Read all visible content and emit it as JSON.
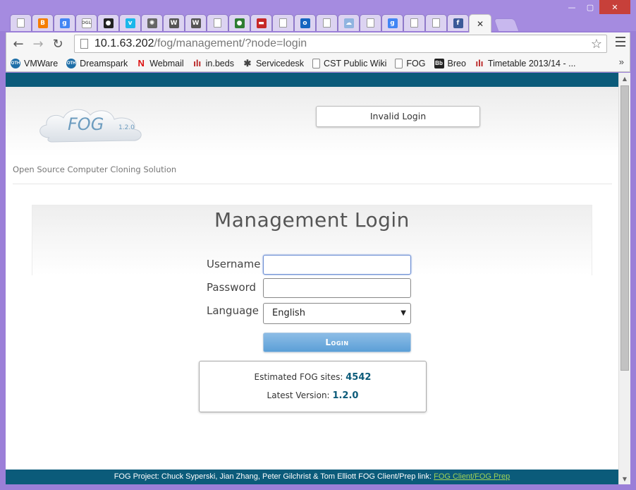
{
  "window": {
    "minimize": "—",
    "maximize": "▢",
    "close": "✕"
  },
  "tabs": [
    {
      "icon": "doc"
    },
    {
      "icon": "blogger",
      "color": "#f57d00",
      "glyph": "B"
    },
    {
      "icon": "google",
      "color": "#4285f4",
      "glyph": "g"
    },
    {
      "icon": "ogl",
      "color": "#777777",
      "glyph": "OGL"
    },
    {
      "icon": "github",
      "color": "#222222",
      "glyph": "●"
    },
    {
      "icon": "vimeo",
      "color": "#1ab7ea",
      "glyph": "v"
    },
    {
      "icon": "gear",
      "color": "#666666",
      "glyph": "✺"
    },
    {
      "icon": "wikipedia",
      "color": "#555555",
      "glyph": "W"
    },
    {
      "icon": "wikipedia",
      "color": "#555555",
      "glyph": "W"
    },
    {
      "icon": "doc"
    },
    {
      "icon": "circle-green",
      "color": "#2e7d32",
      "glyph": "●"
    },
    {
      "icon": "ikea",
      "color": "#c62828",
      "glyph": "▬"
    },
    {
      "icon": "doc"
    },
    {
      "icon": "outlook",
      "color": "#1565c0",
      "glyph": "o"
    },
    {
      "icon": "doc"
    },
    {
      "icon": "cloud",
      "color": "#90b4e0",
      "glyph": "☁"
    },
    {
      "icon": "doc"
    },
    {
      "icon": "google",
      "color": "#4285f4",
      "glyph": "g"
    },
    {
      "icon": "doc"
    },
    {
      "icon": "doc"
    },
    {
      "icon": "facebook",
      "color": "#3b5998",
      "glyph": "f"
    }
  ],
  "active_tab": {
    "close": "✕"
  },
  "toolbar": {
    "back": "←",
    "forward": "→",
    "reload": "↻",
    "url_host": "10.1.63.202",
    "url_path": "/fog/management/?node=login",
    "star": "☆"
  },
  "bookmarks": [
    {
      "label": "VMWare",
      "icon": "oth-icon",
      "color": "#1f6fa8",
      "glyph": "OTH"
    },
    {
      "label": "Dreamspark",
      "icon": "oth-icon",
      "color": "#1f6fa8",
      "glyph": "OTH"
    },
    {
      "label": "Webmail",
      "icon": "n-icon",
      "color": "#d11",
      "glyph": "N"
    },
    {
      "label": "in.beds",
      "icon": "bars-icon",
      "color": "#b71c1c",
      "glyph": "ılı"
    },
    {
      "label": "Servicedesk",
      "icon": "asterisk-icon",
      "color": "#444",
      "glyph": "✱"
    },
    {
      "label": "CST Public Wiki",
      "icon": "doc-icon",
      "color": "#ffffff",
      "glyph": ""
    },
    {
      "label": "FOG",
      "icon": "doc-icon",
      "color": "#ffffff",
      "glyph": ""
    },
    {
      "label": "Breo",
      "icon": "bb-icon",
      "color": "#222",
      "glyph": "Bb"
    },
    {
      "label": "Timetable 2013/14 - ...",
      "icon": "bars-icon",
      "color": "#b71c1c",
      "glyph": "ılı"
    }
  ],
  "bookmarks_more": "»",
  "page": {
    "logo_text": "FOG",
    "logo_version": "1.2.0",
    "tagline": "Open Source Computer Cloning Solution",
    "notice": "Invalid Login",
    "login_title": "Management Login",
    "username_label": "Username",
    "password_label": "Password",
    "language_label": "Language",
    "language_value": "English",
    "language_arrow": "▼",
    "login_button": "Login",
    "stats_sites_label": "Estimated FOG sites:",
    "stats_sites_value": "4542",
    "stats_version_label": "Latest Version:",
    "stats_version_value": "1.2.0",
    "footer_text": "FOG Project: Chuck Syperski, Jian Zhang, Peter Gilchrist & Tom Elliott FOG Client/Prep link:",
    "footer_link": "FOG Client/FOG Prep"
  },
  "scrollbar": {
    "up": "▲",
    "down": "▼"
  },
  "colors": {
    "brand_teal": "#0b5b7a",
    "frame_purple": "#9b7fd8",
    "button_blue": "#5b9fd7",
    "footer_link": "#9fd256"
  }
}
